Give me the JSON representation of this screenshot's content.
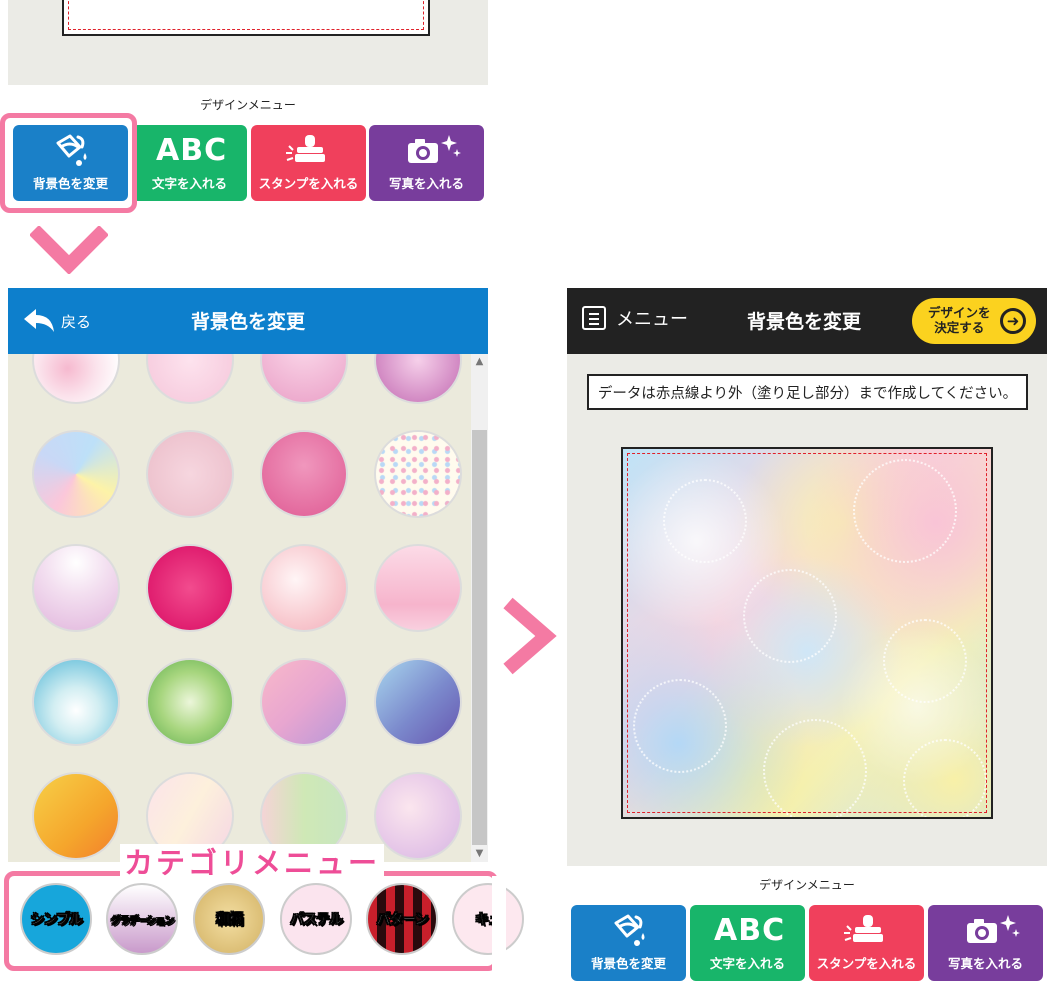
{
  "top_menu": {
    "caption": "デザインメニュー",
    "buttons": [
      {
        "label": "背景色を変更",
        "icon": "paint-bucket-icon"
      },
      {
        "label": "文字を入れる",
        "icon_text": "ABC"
      },
      {
        "label": "スタンプを入れる",
        "icon": "stamp-icon"
      },
      {
        "label": "写真を入れる",
        "icon": "camera-icon"
      }
    ]
  },
  "left_panel": {
    "back_label": "戻る",
    "title": "背景色を変更",
    "category_label": "カテゴリメニュー",
    "categories": [
      {
        "label": "シンプル"
      },
      {
        "label": "グラデーション"
      },
      {
        "label": "和柄"
      },
      {
        "label": "パステル"
      },
      {
        "label": "パターン"
      },
      {
        "label": "キュ"
      }
    ]
  },
  "right_panel": {
    "menu_label": "メニュー",
    "title": "背景色を変更",
    "decide_line1": "デザインを",
    "decide_line2": "決定する",
    "notice": "データは赤点線より外（塗り足し部分）まで作成してください。",
    "caption": "デザインメニュー",
    "buttons": [
      {
        "label": "背景色を変更"
      },
      {
        "label": "文字を入れる",
        "icon_text": "ABC"
      },
      {
        "label": "スタンプを入れる"
      },
      {
        "label": "写真を入れる"
      }
    ]
  },
  "colors": {
    "blue": "#1a80c8",
    "green": "#18b56a",
    "red": "#f0405c",
    "purple": "#783d9c",
    "highlight_pink": "#f47aa3",
    "decide_yellow": "#fbd21f"
  }
}
